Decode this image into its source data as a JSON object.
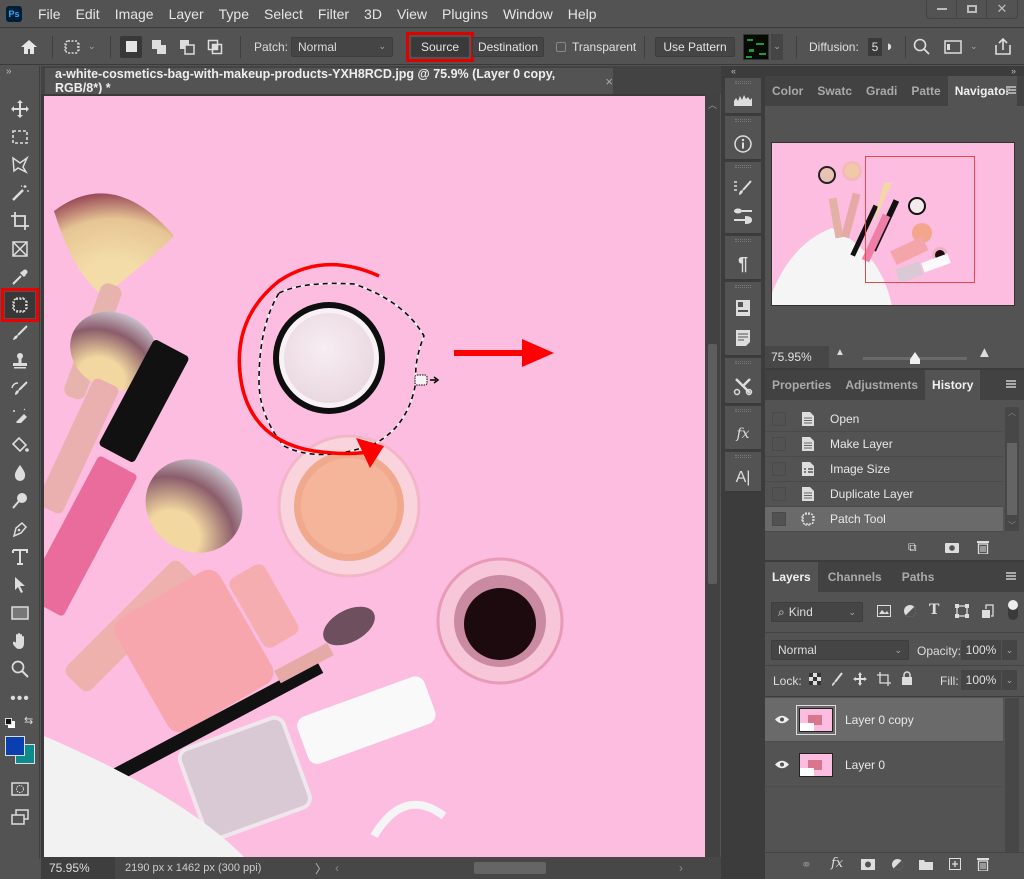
{
  "app": {
    "logo": "Ps",
    "menu": [
      "File",
      "Edit",
      "Image",
      "Layer",
      "Type",
      "Select",
      "Filter",
      "3D",
      "View",
      "Plugins",
      "Window",
      "Help"
    ],
    "window_controls": [
      "minimize",
      "restore",
      "close"
    ]
  },
  "options_bar": {
    "patch_label": "Patch:",
    "patch_mode": "Normal",
    "source_label": "Source",
    "destination_label": "Destination",
    "transparent_label": "Transparent",
    "transparent_checked": false,
    "use_pattern_label": "Use Pattern",
    "diffusion_label": "Diffusion:",
    "diffusion_value": "5",
    "highlighted_button": "Source",
    "highlight_color": "#e00000"
  },
  "document": {
    "tab_title": "a-white-cosmetics-bag-with-makeup-products-YXH8RCD.jpg @ 75.9% (Layer 0 copy, RGB/8*) *",
    "close_glyph": "×"
  },
  "toolbar": {
    "tools": [
      "move",
      "marquee",
      "lasso",
      "magic-wand",
      "crop",
      "frame",
      "eyedropper",
      "patch",
      "brush",
      "clone-stamp",
      "history-brush",
      "eraser",
      "paint-bucket",
      "blur",
      "dodge",
      "pen",
      "type",
      "path-selection",
      "rectangle",
      "hand",
      "zoom",
      "more"
    ],
    "active_tool": "patch",
    "foreground_color": "#0a3fb0",
    "background_color": "#0d8a8c"
  },
  "status_bar": {
    "zoom": "75.95%",
    "dimensions": "2190 px x 1462 px (300 ppi)",
    "arrow": "〉"
  },
  "annotations": {
    "arrow_color": "#ff0000"
  },
  "navigator_panel": {
    "tabs": [
      "Color",
      "Swatc",
      "Gradi",
      "Patte",
      "Navigator"
    ],
    "active_tab": "Navigator",
    "zoom": "75.95%",
    "zoom_slider_fraction": 0.5,
    "view_box_color": "#e84a4a"
  },
  "history_panel": {
    "tabs": [
      "Properties",
      "Adjustments",
      "History"
    ],
    "active_tab": "History",
    "items": [
      {
        "label": "Open",
        "icon": "document-icon"
      },
      {
        "label": "Make Layer",
        "icon": "document-icon"
      },
      {
        "label": "Image Size",
        "icon": "list-icon"
      },
      {
        "label": "Duplicate Layer",
        "icon": "document-icon"
      },
      {
        "label": "Patch Tool",
        "icon": "patch-icon"
      }
    ],
    "selected_index": 4
  },
  "layers_panel": {
    "tabs": [
      "Layers",
      "Channels",
      "Paths"
    ],
    "active_tab": "Layers",
    "filter_kind": "Kind",
    "blend_mode": "Normal",
    "opacity_label": "Opacity:",
    "opacity_value": "100%",
    "lock_label": "Lock:",
    "fill_label": "Fill:",
    "fill_value": "100%",
    "layers": [
      {
        "name": "Layer 0 copy",
        "visible": true,
        "selected": true
      },
      {
        "name": "Layer 0",
        "visible": true,
        "selected": false
      }
    ]
  }
}
